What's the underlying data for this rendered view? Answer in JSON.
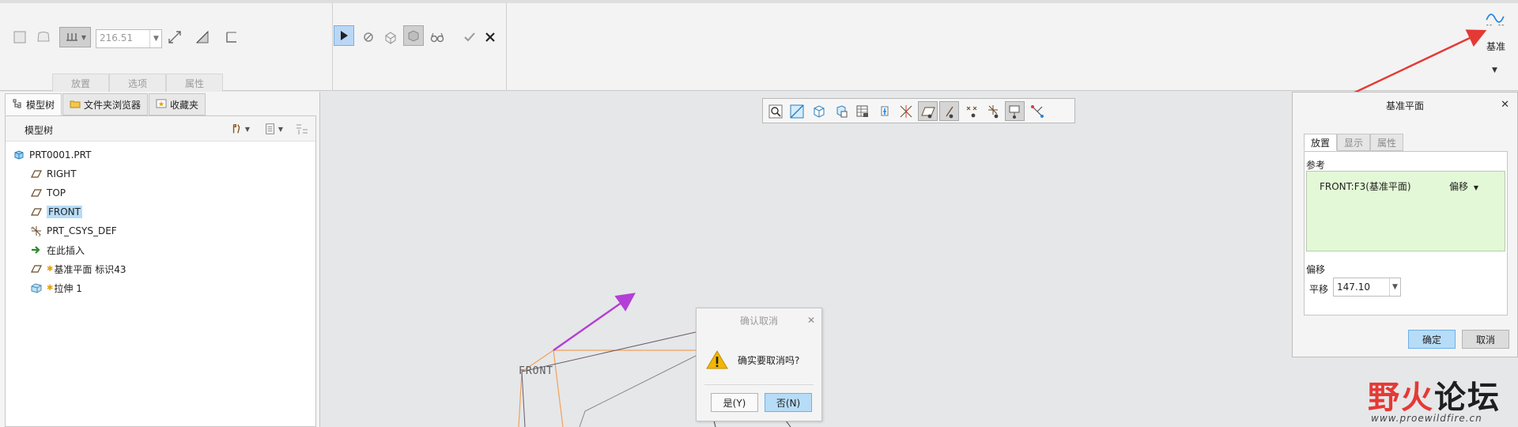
{
  "ribbon": {
    "offset_value": "216.51",
    "tabs": [
      "放置",
      "选项",
      "属性"
    ],
    "datum_label": "基准"
  },
  "left_panel": {
    "tabs": [
      "模型树",
      "文件夹浏览器",
      "收藏夹"
    ],
    "tree_title": "模型树",
    "tree": [
      {
        "label": "PRT0001.PRT",
        "icon": "part-icon"
      },
      {
        "label": "RIGHT",
        "icon": "datum-plane-icon"
      },
      {
        "label": "TOP",
        "icon": "datum-plane-icon"
      },
      {
        "label": "FRONT",
        "icon": "datum-plane-icon",
        "selected": true
      },
      {
        "label": "PRT_CSYS_DEF",
        "icon": "csys-icon"
      },
      {
        "label": "在此插入",
        "icon": "insert-arrow-icon"
      },
      {
        "label": "基准平面 标识43",
        "icon": "datum-plane-icon",
        "new": true
      },
      {
        "label": "拉伸 1",
        "icon": "extrude-icon",
        "new": true
      }
    ]
  },
  "viewport": {
    "front_label": "FRONT"
  },
  "confirm_dialog": {
    "title": "确认取消",
    "message": "确实要取消吗?",
    "yes": "是(Y)",
    "no": "否(N)"
  },
  "datum_dialog": {
    "title": "基准平面",
    "tabs": [
      "放置",
      "显示",
      "属性"
    ],
    "reference_label": "参考",
    "reference_item": "FRONT:F3(基准平面)",
    "reference_mode": "偏移",
    "offset_label": "偏移",
    "translation_label": "平移",
    "translation_value": "147.10",
    "ok": "确定",
    "cancel": "取消"
  },
  "watermark": {
    "text_a": "野",
    "text_b": "火",
    "text_c": "论坛",
    "url": "www.proewildfire.cn"
  },
  "colors": {
    "accent_blue": "#b6dcf7",
    "reference_green": "#e3f8d6",
    "annotation_red": "#e53935",
    "annotation_purple": "#b340d6",
    "geometry_orange": "#f0a15a"
  }
}
